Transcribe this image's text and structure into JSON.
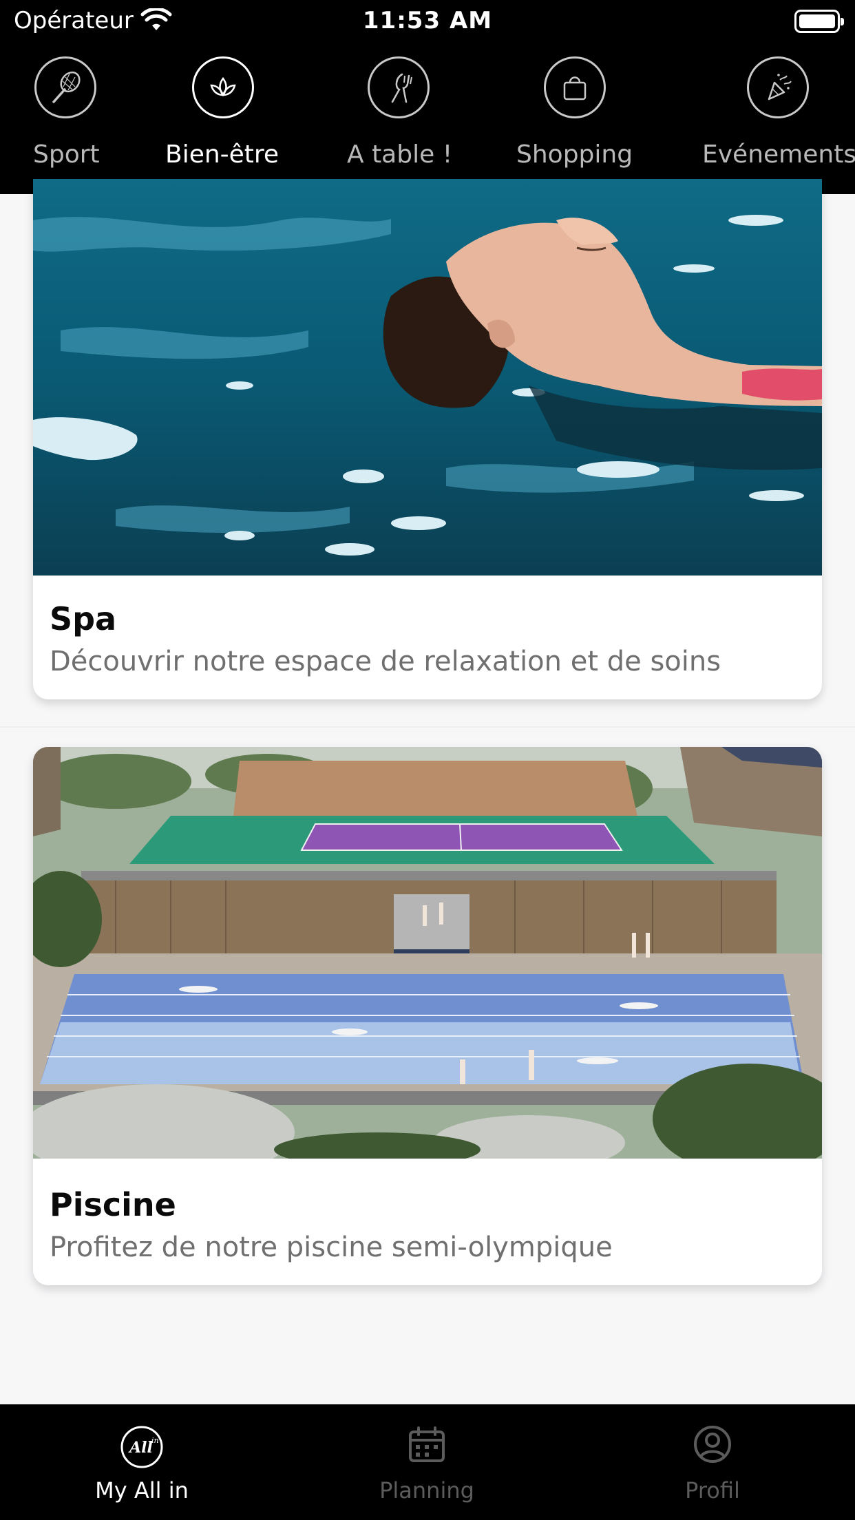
{
  "status_bar": {
    "carrier": "Opérateur",
    "time": "11:53 AM"
  },
  "categories": [
    {
      "label": "Sport",
      "icon": "tennis-racket-icon"
    },
    {
      "label": "Bien-être",
      "icon": "lotus-icon",
      "active": true
    },
    {
      "label": "A table !",
      "icon": "fork-knife-icon"
    },
    {
      "label": "Shopping",
      "icon": "shopping-bag-icon"
    },
    {
      "label": "Evénements",
      "icon": "party-popper-icon"
    }
  ],
  "cards": [
    {
      "title": "Spa",
      "description": "Découvrir notre espace de relaxation et de soins",
      "image": "woman-floating-in-pool-photo"
    },
    {
      "title": "Piscine",
      "description": "Profitez de notre piscine semi-olympique",
      "image": "outdoor-pool-and-tennis-courts-rendering"
    }
  ],
  "tabs": [
    {
      "label": "My All in",
      "icon": "all-in-logo-icon",
      "active": true
    },
    {
      "label": "Planning",
      "icon": "calendar-icon"
    },
    {
      "label": "Profil",
      "icon": "user-circle-icon"
    }
  ],
  "colors": {
    "nav_background": "#000000",
    "page_background": "#f7f7f8",
    "active_text": "#ffffff",
    "inactive_text": "#b9b9b9",
    "tab_inactive": "#5c5c5c",
    "description_text": "#6f6f6f"
  }
}
